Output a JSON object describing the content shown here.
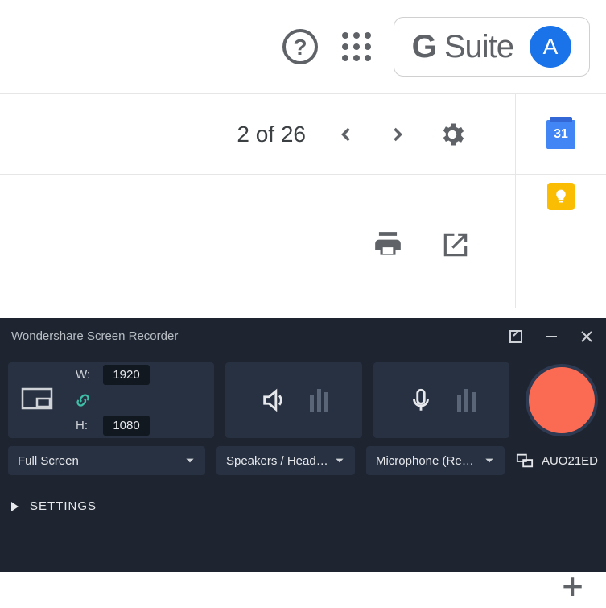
{
  "header": {
    "gsuite_label": "Suite",
    "avatar_letter": "A"
  },
  "subrow": {
    "counter": "2 of 26"
  },
  "sidebar": {
    "calendar_day": "31"
  },
  "recorder": {
    "title": "Wondershare Screen Recorder",
    "width_label": "W:",
    "width_value": "1920",
    "height_label": "H:",
    "height_value": "1080",
    "screen_select": "Full Screen",
    "audio_select": "Speakers / Headpho...",
    "mic_select": "Microphone (Realtek...",
    "display_device": "AUO21ED",
    "settings_label": "SETTINGS"
  }
}
